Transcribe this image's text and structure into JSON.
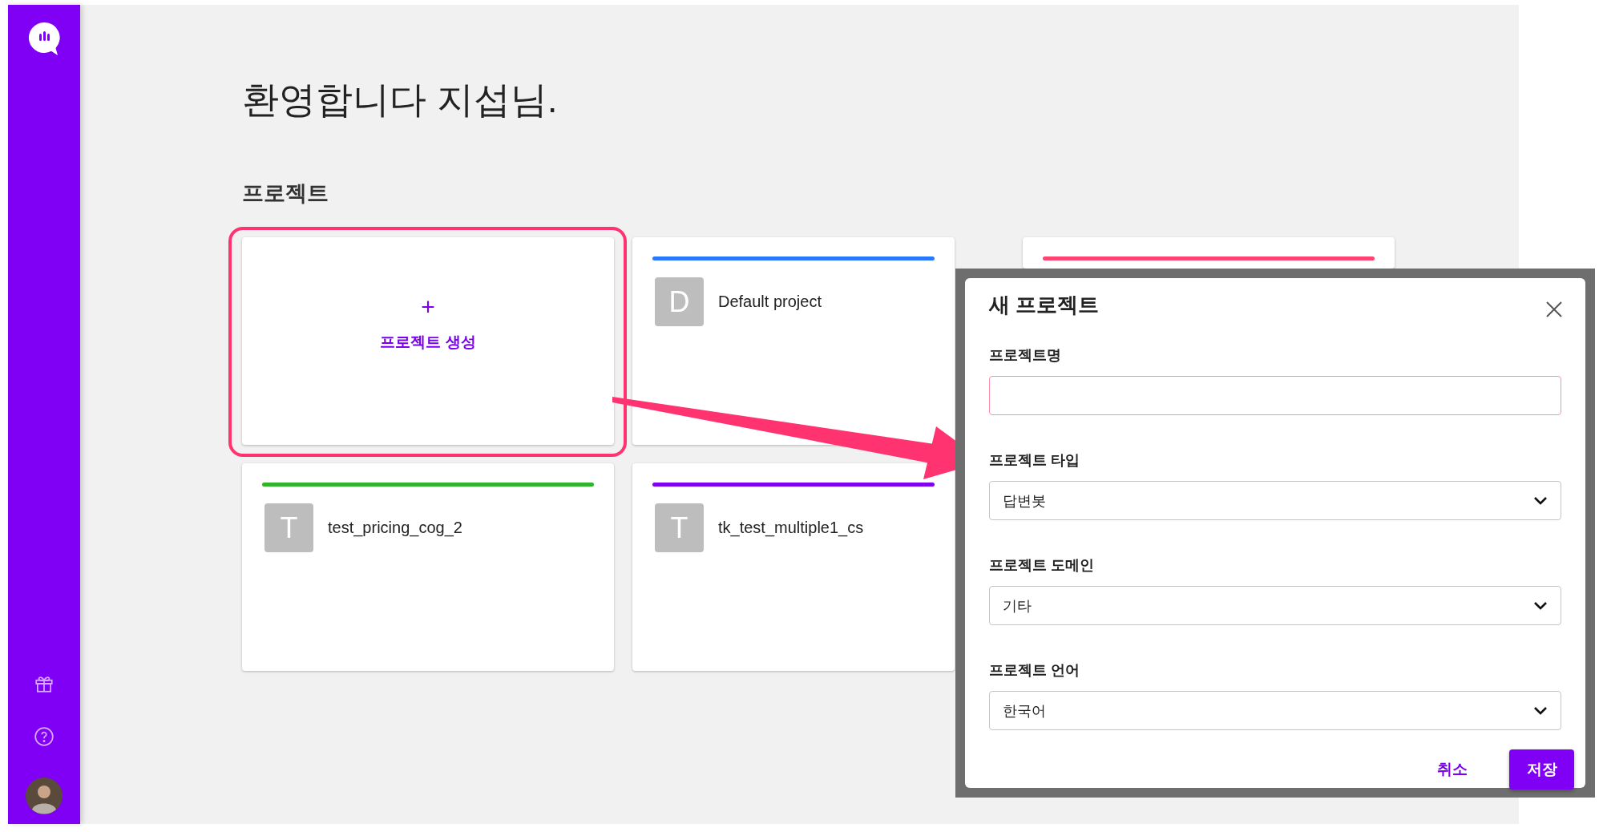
{
  "greeting": "환영합니다 지섭님.",
  "section_title": "프로젝트",
  "create_card": {
    "symbol": "+",
    "label": "프로젝트 생성",
    "highlighted": true
  },
  "projects": [
    {
      "initial": "D",
      "name": "Default project",
      "color": "#2979ff"
    },
    {
      "color": "#ff4472"
    },
    {
      "initial": "T",
      "name": "test_pricing_cog_2",
      "color": "#2fb52a"
    },
    {
      "initial": "T",
      "name": "tk_test_multiple1_cs",
      "color": "#8000f0"
    }
  ],
  "dialog": {
    "title": "새 프로젝트",
    "fields": [
      {
        "kind": "text",
        "label": "프로젝트명",
        "error": true
      },
      {
        "kind": "select",
        "label": "프로젝트 타입",
        "value": "답변봇"
      },
      {
        "kind": "select",
        "label": "프로젝트 도메인",
        "value": "기타"
      },
      {
        "kind": "select",
        "label": "프로젝트 언어",
        "value": "한국어"
      }
    ],
    "cancel": "취소",
    "save": "저장"
  }
}
